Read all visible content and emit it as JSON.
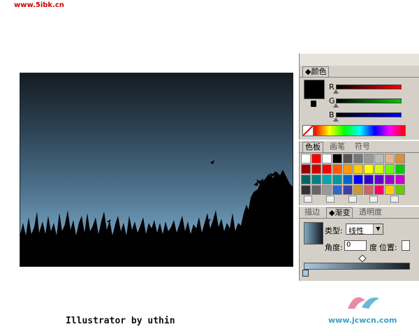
{
  "watermark_top": "www.5ibk.cn",
  "credit": "Illustrator by uthin",
  "watermark_bottom": "www.jcwcn.com",
  "color_panel": {
    "tab": "颜色",
    "channels": [
      "R",
      "G",
      "B"
    ],
    "fill_color": "#000000"
  },
  "swatches_panel": {
    "tabs": [
      "色板",
      "画笔",
      "符号"
    ],
    "colors": [
      [
        "#ffffff",
        "#ff0000",
        "#ffffff",
        "#000000",
        "#555555",
        "#777777",
        "#999999",
        "#bbbbbb",
        "#e0b890",
        "#d89040"
      ],
      [
        "#990000",
        "#cc0000",
        "#ff0000",
        "#ff5a00",
        "#ff9900",
        "#ffcc00",
        "#ffff00",
        "#ccff00",
        "#66ff00",
        "#00cc00"
      ],
      [
        "#006666",
        "#008080",
        "#00aaaa",
        "#009999",
        "#0066cc",
        "#0000ff",
        "#3300cc",
        "#6600cc",
        "#9900cc",
        "#cc00cc"
      ],
      [
        "#333333",
        "#666666",
        "#999999",
        "#3366cc",
        "#4040a0",
        "#cc9933",
        "#cc6666",
        "#ff0066",
        "#ffcc00",
        "#66cc00"
      ]
    ]
  },
  "gradient_panel": {
    "tabs": [
      "描边",
      "渐变",
      "透明度"
    ],
    "type_label": "类型:",
    "type_value": "线性",
    "angle_label": "角度:",
    "angle_value": "0",
    "angle_unit": "度",
    "position_label": "位置:",
    "start_color": "#7fa9c4",
    "end_color": "#141c20"
  }
}
